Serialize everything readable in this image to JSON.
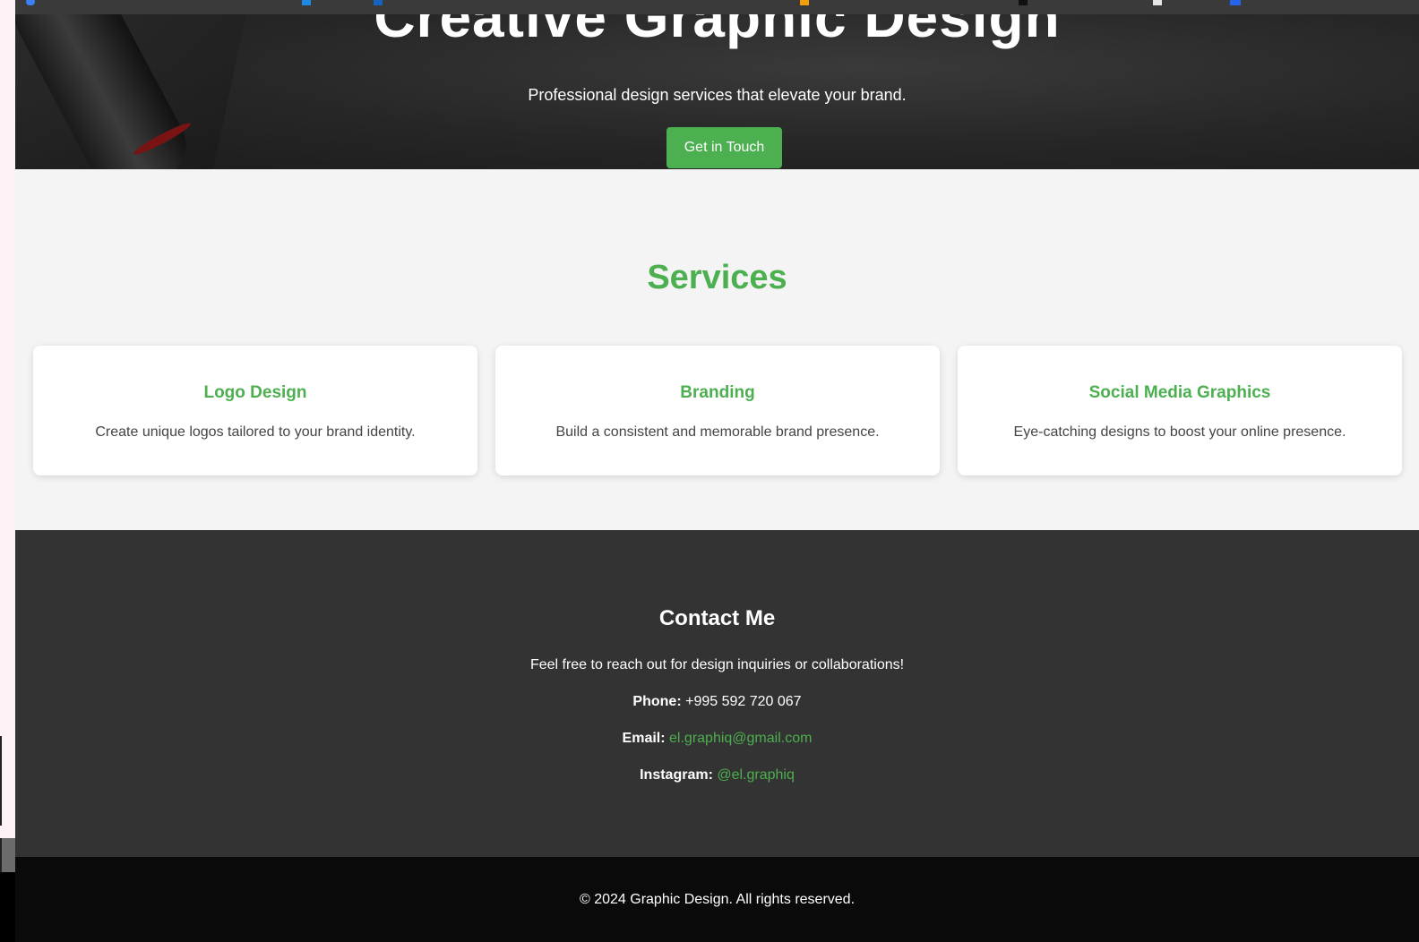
{
  "hero": {
    "title": "Creative Graphic Design",
    "subtitle": "Professional design services that elevate your brand.",
    "cta_label": "Get in Touch"
  },
  "services": {
    "title": "Services",
    "cards": [
      {
        "title": "Logo Design",
        "description": "Create unique logos tailored to your brand identity."
      },
      {
        "title": "Branding",
        "description": "Build a consistent and memorable brand presence."
      },
      {
        "title": "Social Media Graphics",
        "description": "Eye-catching designs to boost your online presence."
      }
    ]
  },
  "contact": {
    "title": "Contact Me",
    "intro": "Feel free to reach out for design inquiries or collaborations!",
    "phone_label": "Phone:",
    "phone": "+995 592 720 067",
    "email_label": "Email:",
    "email": "el.graphiq@gmail.com",
    "instagram_label": "Instagram:",
    "instagram": "@el.graphiq"
  },
  "footer": {
    "copyright": "© 2024 Graphic Design. All rights reserved."
  },
  "colors": {
    "accent": "#4caf50",
    "contact_bg": "#333333",
    "footer_bg": "#0a0a0a",
    "services_bg": "#f4f4f4"
  }
}
